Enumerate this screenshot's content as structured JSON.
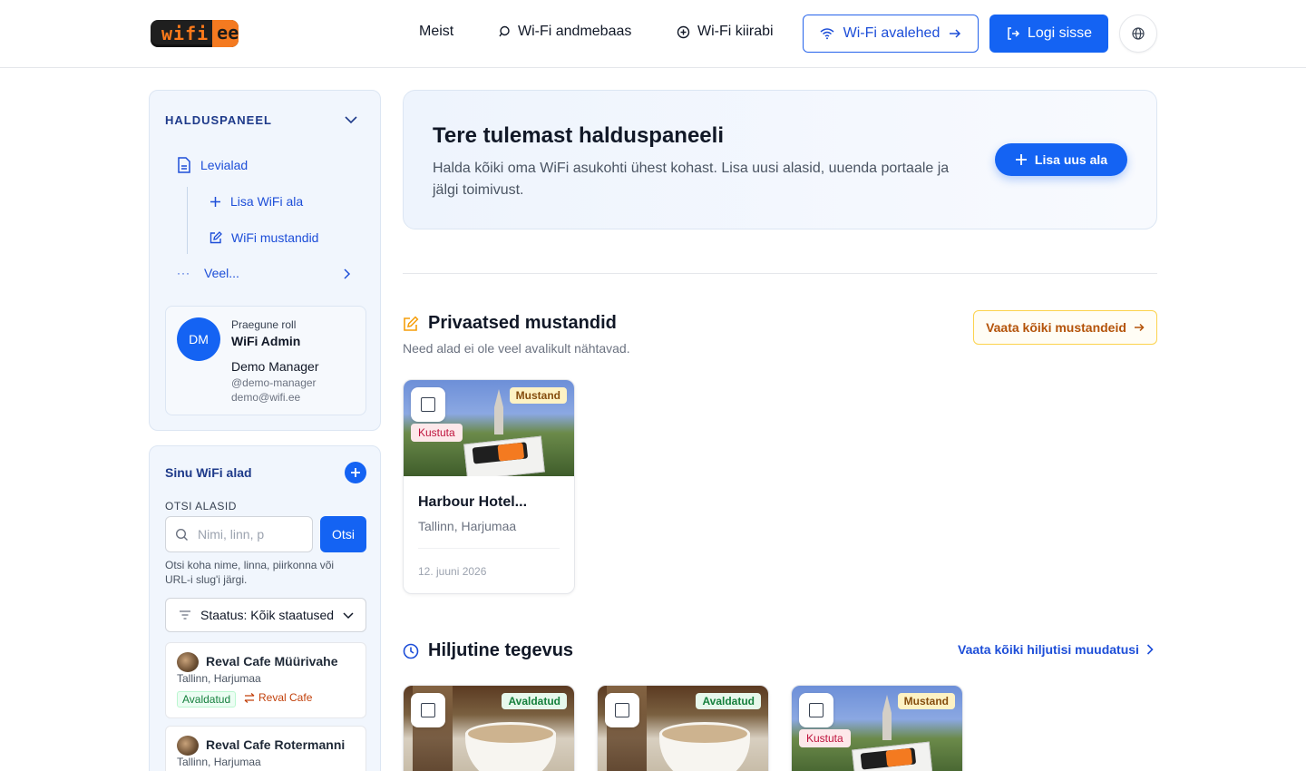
{
  "header": {
    "logo_left": "wifi",
    "logo_right": "ee",
    "nav": {
      "about": "Meist",
      "database": "Wi-Fi andmebaas",
      "first_aid": "Wi-Fi kiirabi"
    },
    "portals_button": "Wi-Fi avalehed",
    "login_button": "Logi sisse"
  },
  "sidebar": {
    "panel_title": "HALDUSPANEEL",
    "items": [
      {
        "label": "Levialad",
        "icon": "document-icon"
      },
      {
        "label": "Lisa WiFi ala",
        "icon": "plus-icon"
      },
      {
        "label": "WiFi mustandid",
        "icon": "edit-icon"
      },
      {
        "label": "Veel...",
        "icon": "dots-icon"
      }
    ],
    "role": {
      "avatar_initials": "DM",
      "label": "Praegune roll",
      "value": "WiFi Admin",
      "name": "Demo Manager",
      "handle": "@demo-manager",
      "email": "demo@wifi.ee"
    },
    "areas": {
      "title": "Sinu WiFi alad",
      "search_label": "OTSI ALASID",
      "search_placeholder": "Nimi, linn, p",
      "search_button": "Otsi",
      "search_hint": "Otsi koha nime, linna, piirkonna või URL-i slug'i järgi.",
      "status_filter": "Staatus: Kõik staatused",
      "list": [
        {
          "name": "Reval Cafe Müürivahe",
          "location": "Tallinn, Harjumaa",
          "status": "Avaldatud",
          "extra": "Reval Cafe"
        },
        {
          "name": "Reval Cafe Rotermanni",
          "location": "Tallinn, Harjumaa"
        }
      ]
    }
  },
  "main": {
    "welcome": {
      "title": "Tere tulemast halduspaneeli",
      "description": "Halda kõiki oma WiFi asukohti ühest kohast. Lisa uusi alasid, uuenda portaale ja jälgi toimivust.",
      "add_button": "Lisa uus ala"
    },
    "drafts": {
      "title": "Privaatsed mustandid",
      "subtitle": "Need alad ei ole veel avalikult nähtavad.",
      "view_all": "Vaata kõiki mustandeid",
      "cards": [
        {
          "name": "Harbour Hotel...",
          "location": "Tallinn, Harjumaa",
          "date": "12. juuni 2026",
          "badge": "Mustand",
          "delete": "Kustuta"
        }
      ]
    },
    "recent": {
      "title": "Hiljutine tegevus",
      "view_all": "Vaata kõiki hiljutisi muudatusi",
      "cards": [
        {
          "badge": "Avaldatud"
        },
        {
          "badge": "Avaldatud"
        },
        {
          "badge": "Mustand",
          "delete": "Kustuta"
        }
      ]
    }
  },
  "colors": {
    "primary": "#1463f3",
    "draft_badge": "#fdf2c4",
    "published_badge": "#e7f8ec",
    "delete_badge": "#fde8ea"
  }
}
